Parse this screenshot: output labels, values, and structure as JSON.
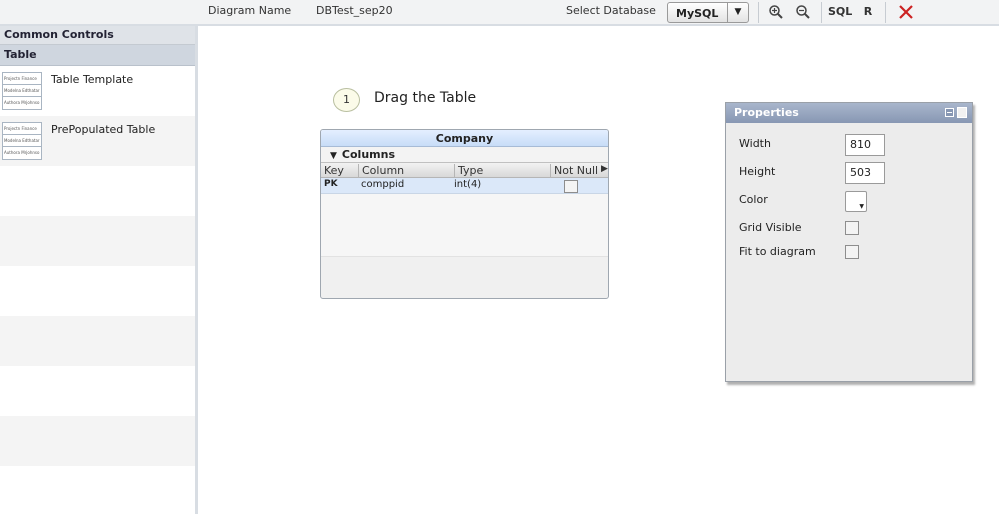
{
  "toolbar": {
    "diagram_name_label": "Diagram Name",
    "diagram_name_value": "DBTest_sep20",
    "select_database_label": "Select Database",
    "database_selected": "MySQL",
    "dropdown_arrow": "▼",
    "sql_label": "SQL",
    "r_label": "R",
    "icons": [
      "zoom-in-icon",
      "zoom-out-icon",
      "close-icon"
    ],
    "close_color": "#cc2222"
  },
  "left_panel": {
    "header": "Common Controls",
    "section": "Table",
    "items": [
      {
        "label": "Table Template",
        "thumb_rows": [
          "Projectn Finance",
          "Modelna Edthatar",
          "Authora Mrjohnso"
        ]
      },
      {
        "label": "PrePopulated Table",
        "thumb_rows": [
          "Projectn Finance",
          "Modelna Edthatar",
          "Authora Mrjohnso"
        ]
      }
    ]
  },
  "canvas": {
    "step_number": "1",
    "step_text": "Drag the Table",
    "table": {
      "title": "Company",
      "section": "Columns",
      "section_toggle": "▼",
      "headers": [
        "Key",
        "Column",
        "Type",
        "Not Null"
      ],
      "header_arrow": "▶",
      "rows": [
        {
          "key": "PK",
          "column": "comppid",
          "type": "int(4)",
          "not_null": false
        }
      ]
    }
  },
  "properties": {
    "title": "Properties",
    "width_label": "Width",
    "width_value": "810",
    "height_label": "Height",
    "height_value": "503",
    "color_label": "Color",
    "color_dropdown": "▼",
    "grid_visible_label": "Grid Visible",
    "grid_visible": false,
    "fit_to_diagram_label": "Fit to diagram",
    "fit_to_diagram": false
  }
}
